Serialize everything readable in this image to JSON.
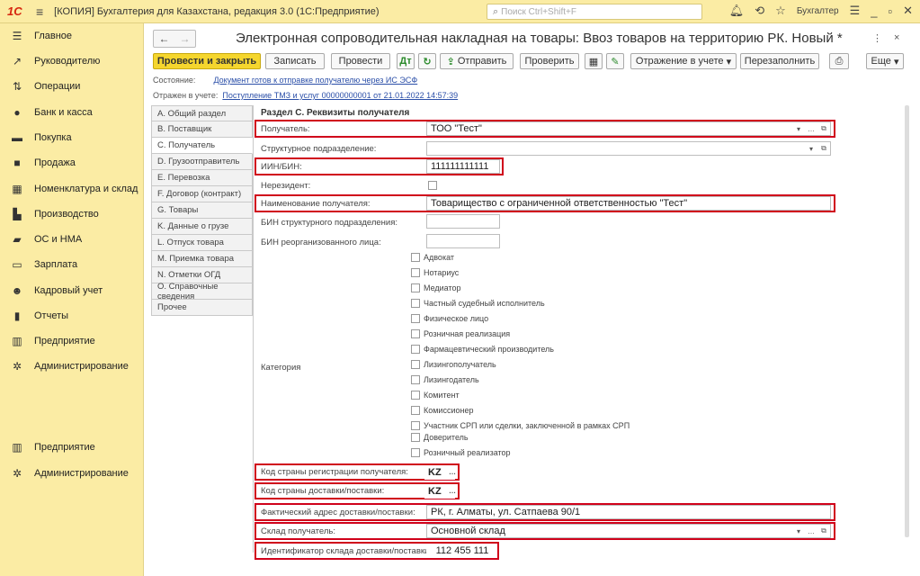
{
  "topbar": {
    "logo": "1С",
    "title": "[КОПИЯ] Бухгалтерия для Казахстана, редакция 3.0  (1С:Предприятие)",
    "search_placeholder": "Поиск Ctrl+Shift+F",
    "user": "Бухгалтер"
  },
  "sidebar": {
    "items": [
      {
        "label": "Главное",
        "icon": "menu-icon"
      },
      {
        "label": "Руководителю",
        "icon": "trend-icon"
      },
      {
        "label": "Операции",
        "icon": "operations-icon"
      },
      {
        "label": "Банк и касса",
        "icon": "bank-icon"
      },
      {
        "label": "Покупка",
        "icon": "cart-icon"
      },
      {
        "label": "Продажа",
        "icon": "bag-icon"
      },
      {
        "label": "Номенклатура и склад",
        "icon": "warehouse-icon"
      },
      {
        "label": "Производство",
        "icon": "factory-icon"
      },
      {
        "label": "ОС и НМА",
        "icon": "truck-icon"
      },
      {
        "label": "Зарплата",
        "icon": "salary-icon"
      },
      {
        "label": "Кадровый учет",
        "icon": "people-icon"
      },
      {
        "label": "Отчеты",
        "icon": "chart-icon"
      },
      {
        "label": "Предприятие",
        "icon": "enterprise-icon"
      },
      {
        "label": "Администрирование",
        "icon": "gear-icon"
      },
      {
        "label": "Предприятие",
        "icon": "enterprise-icon"
      },
      {
        "label": "Администрирование",
        "icon": "gear-icon"
      }
    ]
  },
  "document": {
    "title": "Электронная сопроводительная накладная на товары: Ввоз товаров на территорию РК. Новый *"
  },
  "toolbar": {
    "post_close": "Провести и закрыть",
    "save": "Записать",
    "post": "Провести",
    "send": "Отправить",
    "check": "Проверить",
    "reflection": "Отражение в учете",
    "refill": "Перезаполнить",
    "more": "Еще"
  },
  "status": {
    "state_label": "Состояние:",
    "state_link": "Документ готов к отправке получателю через ИС ЭСФ",
    "reflected_label": "Отражен в учете:",
    "reflected_link": "Поступление ТМЗ и услуг 00000000001 от 21.01.2022 14:57:39"
  },
  "tabs": [
    "A. Общий раздел",
    "B. Поставщик",
    "C. Получатель",
    "D. Грузоотправитель",
    "E. Перевозка",
    "F. Договор (контракт)",
    "G. Товары",
    "K. Данные о грузе",
    "L. Отпуск товара",
    "M. Приемка товара",
    "N. Отметки ОГД",
    "O. Справочные сведения",
    "Прочее"
  ],
  "active_tab": 2,
  "section": {
    "title": "Раздел С. Реквизиты получателя",
    "recipient_label": "Получатель:",
    "recipient_value": "ТОО \"Тест\"",
    "struct_label": "Структурное подразделение:",
    "struct_value": "",
    "iin_label": "ИИН/БИН:",
    "iin_value": "111111111111",
    "nonresident_label": "Нерезидент:",
    "name_label": "Наименование получателя:",
    "name_value": "Товарищество с ограниченной ответственностью \"Тест\"",
    "bin_struct_label": "БИН структурного подразделения:",
    "bin_reorg_label": "БИН реорганизованного лица:",
    "category_label": "Категория",
    "categories": [
      "Адвокат",
      "Нотариус",
      "Медиатор",
      "Частный судебный исполнитель",
      "Физическое лицо",
      "Розничная реализация",
      "Фармацевтический производитель",
      "Лизингополучатель",
      "Лизингодатель",
      "Комитент",
      "Комиссионер",
      "Участник СРП или сделки, заключенной в рамках СРП",
      "Доверитель",
      "Розничный реализатор"
    ],
    "reg_country_label": "Код страны регистрации получателя:",
    "reg_country_value": "KZ",
    "del_country_label": "Код страны доставки/поставки:",
    "del_country_value": "KZ",
    "address_label": "Фактический адрес доставки/поставки:",
    "address_value": "РК, г. Алматы, ул. Сатпаева 90/1",
    "warehouse_label": "Склад получатель:",
    "warehouse_value": "Основной склад",
    "wh_id_label": "Идентификатор склада доставки/поставки:",
    "wh_id_value": "112 455 111"
  }
}
